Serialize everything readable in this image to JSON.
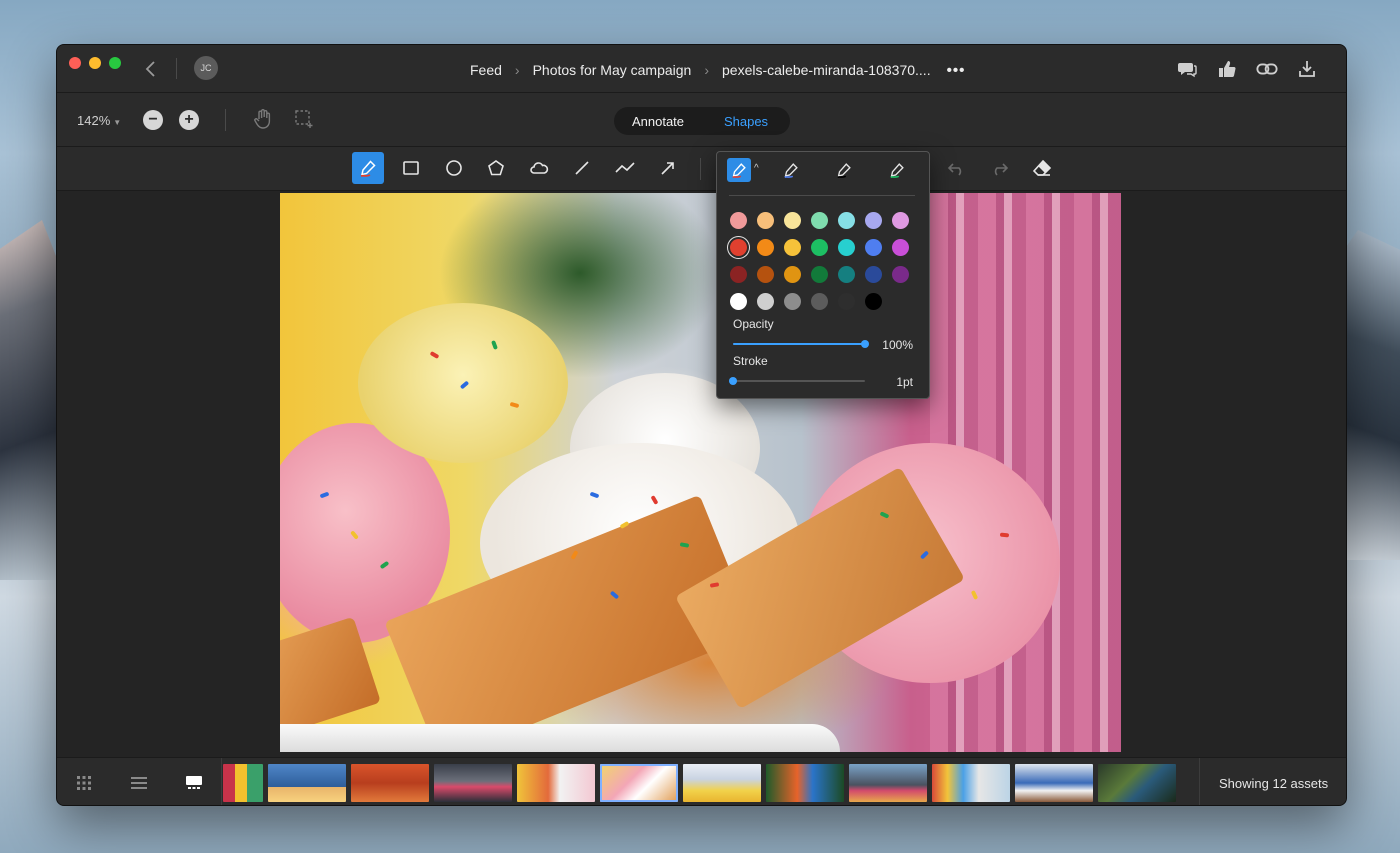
{
  "window": {
    "avatar_initials": "JC",
    "breadcrumbs": [
      "Feed",
      "Photos for May campaign",
      "pexels-calebe-miranda-108370...."
    ],
    "more_label": "•••",
    "right_icons": [
      "comment-icon",
      "thumbs-up-icon",
      "link-icon",
      "download-icon"
    ]
  },
  "zoom": {
    "value": "142%",
    "minus_label": "−",
    "plus_label": "+"
  },
  "mode_tabs": {
    "annotate": "Annotate",
    "shapes": "Shapes",
    "active": "Shapes"
  },
  "tools": [
    "pen-icon",
    "rectangle-icon",
    "circle-icon",
    "pentagon-icon",
    "cloud-icon",
    "line-icon",
    "freehand-line-icon",
    "arrow-icon",
    "undo-icon",
    "redo-icon",
    "eraser-icon"
  ],
  "popover": {
    "pens": [
      "pen-red",
      "pen-blue",
      "pen-black",
      "pen-green"
    ],
    "selected_color": "#e0402f",
    "swatch_rows": [
      [
        "#f09a9a",
        "#f7bf7a",
        "#f8e49a",
        "#7fdcae",
        "#86dfe6",
        "#a7a8ef",
        "#df9ae2"
      ],
      [
        "#e0402f",
        "#f28a17",
        "#f6c23a",
        "#1dbf63",
        "#27cfcf",
        "#4f7ef0",
        "#c94fd8"
      ],
      [
        "#8b2323",
        "#b5520f",
        "#e09412",
        "#127a3a",
        "#157f80",
        "#2a4a9a",
        "#7a2a8a"
      ],
      [
        "#ffffff",
        "#cfcfcf",
        "#8d8d8d",
        "#5c5c5c",
        "#2e2e2e",
        "#000000"
      ]
    ],
    "opacity_label": "Opacity",
    "opacity_value": "100%",
    "opacity_fraction": 1.0,
    "stroke_label": "Stroke",
    "stroke_value": "1pt",
    "stroke_fraction": 0.0
  },
  "filmstrip": {
    "view_icons": [
      "grid-view-icon",
      "list-view-icon",
      "filmstrip-view-icon"
    ],
    "thumb_count": 12,
    "selected_index": 5,
    "showing_text": "Showing 12 assets"
  },
  "colors": {
    "accent": "#3aa0ff",
    "active_tool": "#2d8ce6"
  }
}
